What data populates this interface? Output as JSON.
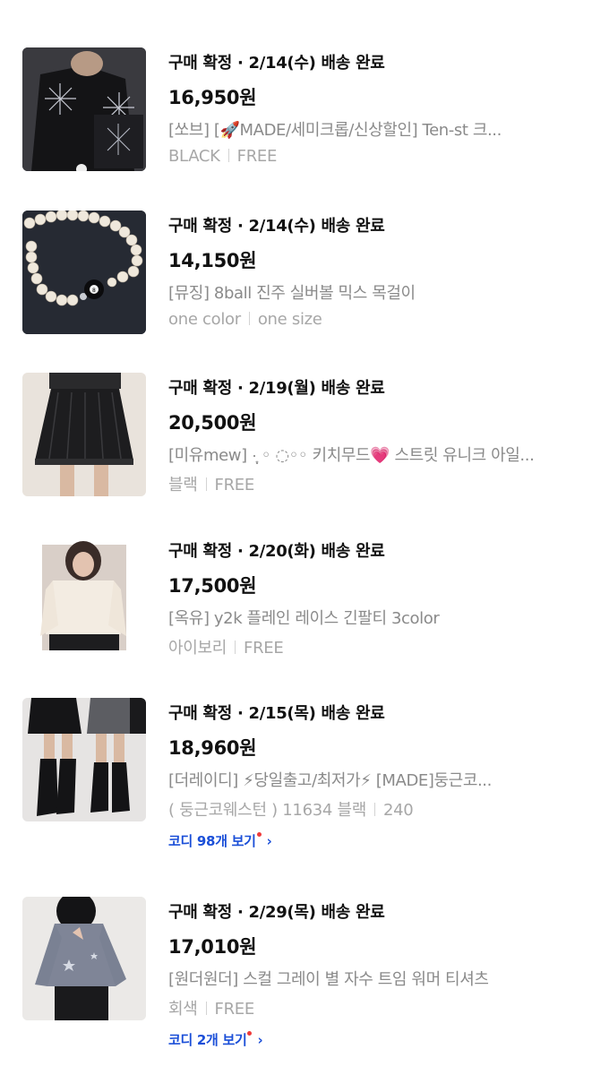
{
  "orders": [
    {
      "status": "구매 확정 · 2/14(수) 배송 완료",
      "price": "16,950원",
      "title": "[쏘브] [🚀MADE/세미크롭/신상할인] Ten-st 크...",
      "option_color": "BLACK",
      "option_size": "FREE",
      "image_icon": "black-graphic-tee-photo"
    },
    {
      "status": "구매 확정 · 2/14(수) 배송 완료",
      "price": "14,150원",
      "title": "[뮤징] 8ball 진주 실버볼 믹스 목걸이",
      "option_color": "one color",
      "option_size": "one size",
      "image_icon": "pearl-necklace-photo"
    },
    {
      "status": "구매 확정 · 2/19(월) 배송 완료",
      "price": "20,500원",
      "title": "[미유mew] ·̩͙ ◦ ◌◦◦ 키치무드💗 스트릿 유니크 아일...",
      "option_color": "블랙",
      "option_size": "FREE",
      "image_icon": "black-pleated-skirt-photo"
    },
    {
      "status": "구매 확정 · 2/20(화) 배송 완료",
      "price": "17,500원",
      "title": "[옥유] y2k 플레인 레이스 긴팔티 3color",
      "option_color": "아이보리",
      "option_size": "FREE",
      "image_icon": "ivory-lace-top-photo"
    },
    {
      "status": "구매 확정 · 2/15(목) 배송 완료",
      "price": "18,960원",
      "title": "[더레이디] ⚡당일출고/최저가⚡ [MADE]둥근코...",
      "option_color": "( 둥근코웨스턴 ) 11634 블랙",
      "option_size": "240",
      "coord_link": "코디 98개 보기",
      "image_icon": "black-western-boots-photo"
    },
    {
      "status": "구매 확정 · 2/29(목) 배송 완료",
      "price": "17,010원",
      "title": "[원더원더] 스컬 그레이 별 자수 트임 워머 티셔츠",
      "option_color": "회색",
      "option_size": "FREE",
      "coord_link": "코디 2개 보기",
      "image_icon": "gray-star-tee-photo"
    }
  ],
  "chevron": "›",
  "colors": {
    "text_primary": "#111111",
    "text_secondary": "#8a8a8a",
    "text_tertiary": "#a7a7a7",
    "link": "#1b4fd8",
    "dot": "#ef3b3b"
  }
}
